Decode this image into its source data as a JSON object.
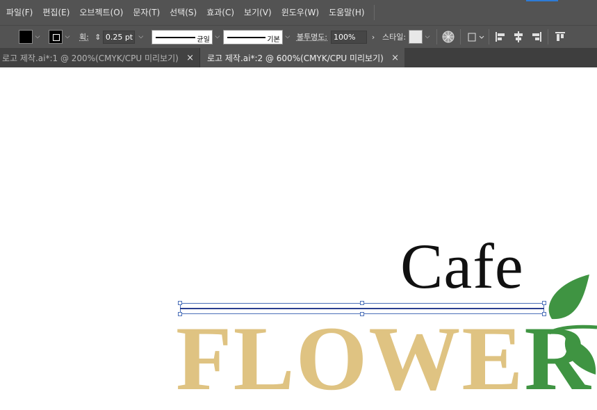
{
  "menu": [
    "파일(F)",
    "편집(E)",
    "오브젝트(O)",
    "문자(T)",
    "선택(S)",
    "효과(C)",
    "보기(V)",
    "윈도우(W)",
    "도움말(H)"
  ],
  "control": {
    "stroke_label": "획:",
    "stroke_weight": "0.25 pt",
    "profile_uniform": "균일",
    "brush_basic": "기본",
    "opacity_label": "불투명도:",
    "opacity_value": "100%",
    "style_label": "스타일:"
  },
  "tabs": [
    {
      "label": "로고 제작.ai*:1 @ 200%(CMYK/CPU 미리보기)",
      "close": "×",
      "active": false
    },
    {
      "label": "로고 제작.ai*:2 @ 600%(CMYK/CPU 미리보기)",
      "close": "×",
      "active": true
    }
  ],
  "artwork": {
    "cafe": "Cafe",
    "flower_main": "FLOWE",
    "flower_last": "R"
  },
  "colors": {
    "ui_dark": "#535353",
    "flower_gold": "#dfc382",
    "flower_green": "#3f9442",
    "selection_blue": "#4a6fb8"
  }
}
